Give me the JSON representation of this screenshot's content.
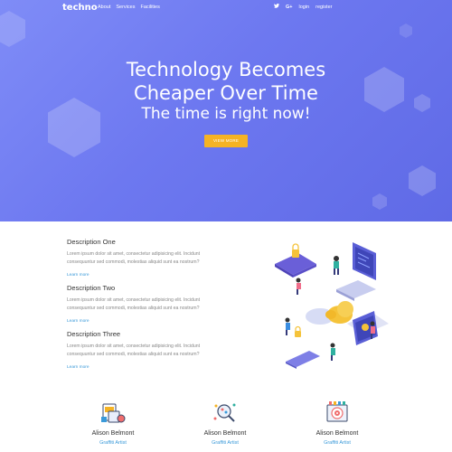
{
  "nav": {
    "brand": "techno",
    "links": [
      "About",
      "Services",
      "Facilities"
    ],
    "social_icons": [
      "twitter-icon",
      "google-plus-icon"
    ],
    "login": "login",
    "register": "register"
  },
  "hero": {
    "title_line1": "Technology Becomes",
    "title_line2": "Cheaper Over Time",
    "subtitle": "The time is right now!",
    "button_label": "VIEW MORE",
    "colors": {
      "gradient_start": "#7f8cf7",
      "gradient_end": "#5f6ae6",
      "button": "#f5b324"
    }
  },
  "descriptions": [
    {
      "title": "Description One",
      "text": "Lorem ipsum dolor sit amet, consectetur adipisicing elit. Incidunt consequuntur sed commodi, molestias aliquid sunt ea nostrum?",
      "link": "Learn more"
    },
    {
      "title": "Description Two",
      "text": "Lorem ipsum dolor sit amet, consectetur adipisicing elit. Incidunt consequuntur sed commodi, molestias aliquid sunt ea nostrum?",
      "link": "Learn more"
    },
    {
      "title": "Description Three",
      "text": "Lorem ipsum dolor sit amet, consectetur adipisicing elit. Incidunt consequuntur sed commodi, molestias aliquid sunt ea nostrum?",
      "link": "Learn more"
    }
  ],
  "team": [
    {
      "name": "Alison Belmont",
      "role": "Graffiti Artist",
      "icon": "design-tools-icon"
    },
    {
      "name": "Alison Belmont",
      "role": "Graffiti Artist",
      "icon": "analytics-magnifier-icon"
    },
    {
      "name": "Alison Belmont",
      "role": "Graffiti Artist",
      "icon": "target-board-icon"
    }
  ],
  "colors": {
    "link": "#3a9ad9"
  }
}
